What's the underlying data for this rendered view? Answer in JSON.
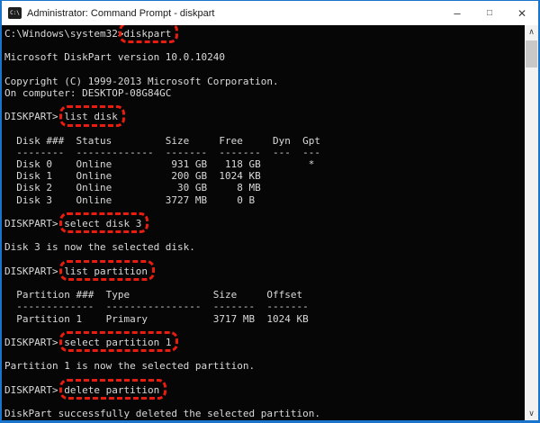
{
  "window": {
    "title": "Administrator: Command Prompt - diskpart",
    "icon_label": "C:\\",
    "controls": {
      "minimize": "–",
      "maximize": "□",
      "close": "✕"
    }
  },
  "colors": {
    "window_border": "#1b74cc",
    "titlebar_bg": "#ffffff",
    "console_bg": "#060606",
    "console_text": "#d9d9d9",
    "annotation_red": "#e91c10",
    "scrollbar_track": "#f2f2f2",
    "scrollbar_thumb": "#c8c8c8"
  },
  "scrollbar": {
    "up": "∧",
    "down": "∨"
  },
  "console": {
    "lines": [
      {
        "prompt": "C:\\Windows\\system32>",
        "command": "diskpart",
        "boxed": true
      },
      {
        "text": ""
      },
      {
        "text": "Microsoft DiskPart version 10.0.10240"
      },
      {
        "text": ""
      },
      {
        "text": "Copyright (C) 1999-2013 Microsoft Corporation."
      },
      {
        "text": "On computer: DESKTOP-08G84GC"
      },
      {
        "text": ""
      },
      {
        "prompt": "DISKPART> ",
        "command": "list disk",
        "boxed": true
      },
      {
        "text": ""
      },
      {
        "text": "  Disk ###  Status         Size     Free     Dyn  Gpt"
      },
      {
        "text": "  --------  -------------  -------  -------  ---  ---"
      },
      {
        "text": "  Disk 0    Online          931 GB   118 GB        *"
      },
      {
        "text": "  Disk 1    Online          200 GB  1024 KB"
      },
      {
        "text": "  Disk 2    Online           30 GB     8 MB"
      },
      {
        "text": "  Disk 3    Online         3727 MB     0 B"
      },
      {
        "text": ""
      },
      {
        "prompt": "DISKPART> ",
        "command": "select disk 3",
        "boxed": true
      },
      {
        "text": ""
      },
      {
        "text": "Disk 3 is now the selected disk."
      },
      {
        "text": ""
      },
      {
        "prompt": "DISKPART> ",
        "command": "list partition",
        "boxed": true
      },
      {
        "text": ""
      },
      {
        "text": "  Partition ###  Type              Size     Offset"
      },
      {
        "text": "  -------------  ----------------  -------  -------"
      },
      {
        "text": "  Partition 1    Primary           3717 MB  1024 KB"
      },
      {
        "text": ""
      },
      {
        "prompt": "DISKPART> ",
        "command": "select partition 1",
        "boxed": true
      },
      {
        "text": ""
      },
      {
        "text": "Partition 1 is now the selected partition."
      },
      {
        "text": ""
      },
      {
        "prompt": "DISKPART> ",
        "command": "delete partition",
        "boxed": true
      },
      {
        "text": ""
      },
      {
        "text": "DiskPart successfully deleted the selected partition."
      }
    ]
  },
  "disk_table": {
    "headers": [
      "Disk ###",
      "Status",
      "Size",
      "Free",
      "Dyn",
      "Gpt"
    ],
    "rows": [
      [
        "Disk 0",
        "Online",
        "931 GB",
        "118 GB",
        "",
        "*"
      ],
      [
        "Disk 1",
        "Online",
        "200 GB",
        "1024 KB",
        "",
        ""
      ],
      [
        "Disk 2",
        "Online",
        "30 GB",
        "8 MB",
        "",
        ""
      ],
      [
        "Disk 3",
        "Online",
        "3727 MB",
        "0 B",
        "",
        ""
      ]
    ]
  },
  "partition_table": {
    "headers": [
      "Partition ###",
      "Type",
      "Size",
      "Offset"
    ],
    "rows": [
      [
        "Partition 1",
        "Primary",
        "3717 MB",
        "1024 KB"
      ]
    ]
  }
}
